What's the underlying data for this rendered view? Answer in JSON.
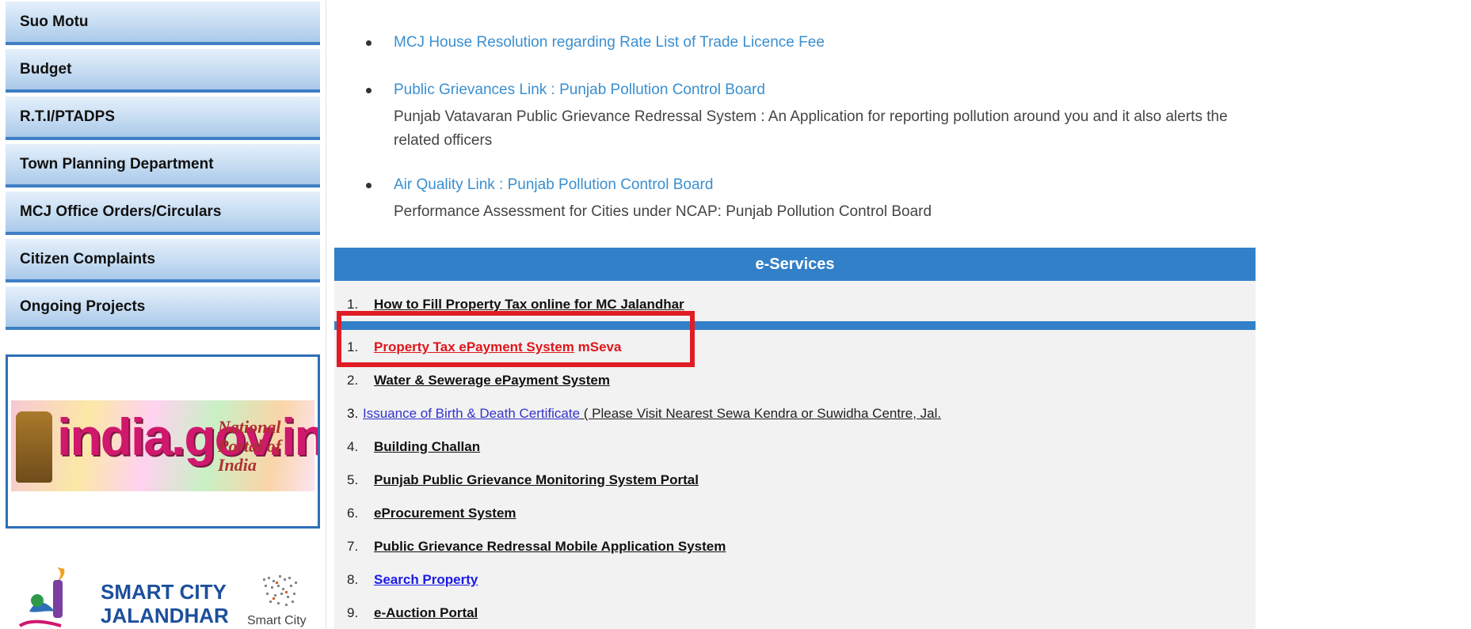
{
  "sidebar": {
    "items": [
      {
        "label": "Suo Motu"
      },
      {
        "label": "Budget"
      },
      {
        "label": "R.T.I/PTADPS"
      },
      {
        "label": "Town Planning Department"
      },
      {
        "label": "MCJ Office Orders/Circulars"
      },
      {
        "label": "Citizen Complaints"
      },
      {
        "label": "Ongoing Projects"
      }
    ],
    "india_banner": {
      "logo_text": "india.gov.in",
      "portal_text": "National Portal of India"
    },
    "smart_city": {
      "line1": "SMART CITY",
      "line2": "JALANDHAR",
      "caption": "Smart City"
    }
  },
  "links": [
    {
      "title": "MCJ House Resolution regarding Rate List of Trade Licence Fee",
      "desc": ""
    },
    {
      "title": "Public Grievances Link : Punjab Pollution Control Board",
      "desc": "Punjab Vatavaran Public Grievance Redressal System : An Application for reporting pollution around you and it also alerts the related officers"
    },
    {
      "title": "Air Quality Link : Punjab Pollution Control Board",
      "desc": "Performance Assessment for Cities under NCAP: Punjab Pollution Control Board"
    }
  ],
  "eservices": {
    "header": "e-Services",
    "top_item": {
      "num": "1.",
      "label": "How to Fill Property Tax online for MC Jalandhar"
    },
    "items": [
      {
        "num": "1.",
        "label": "Property Tax ePayment System",
        "suffix": " mSeva",
        "color": "#e0151b"
      },
      {
        "num": "2.",
        "label": "Water & Sewerage ePayment System",
        "color": "#111111"
      },
      {
        "num": "3.",
        "label": "Issuance of Birth & Death Certificate",
        "suffix": " ( Please Visit Nearest Sewa Kendra or Suwidha Centre, Jal.",
        "color": "#3333cc"
      },
      {
        "num": "4.",
        "label": "Building Challan",
        "color": "#111111"
      },
      {
        "num": "5.",
        "label": "Punjab Public Grievance Monitoring System Portal",
        "color": "#111111"
      },
      {
        "num": "6.",
        "label": "eProcurement System",
        "color": "#111111"
      },
      {
        "num": "7.",
        "label": "Public Grievance Redressal Mobile Application System",
        "color": "#111111"
      },
      {
        "num": "8.",
        "label": "Search Property",
        "color": "#1a1ae6"
      },
      {
        "num": "9.",
        "label": "e-Auction Portal",
        "color": "#111111"
      }
    ]
  }
}
